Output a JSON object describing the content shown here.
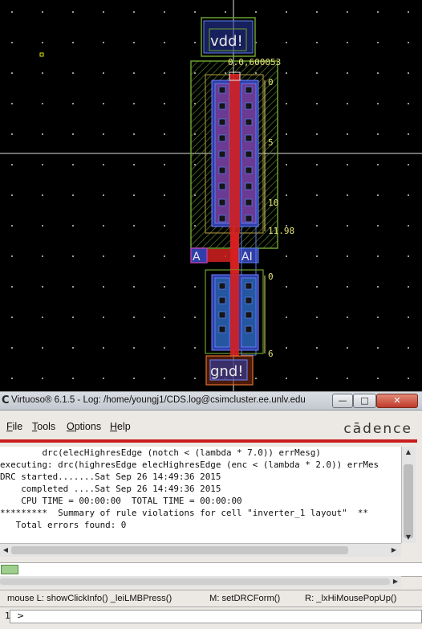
{
  "layout": {
    "pins": {
      "vdd": "vdd!",
      "gnd": "gnd!",
      "input": "A",
      "output": "AI"
    },
    "coordinate_readout": "0.0,600053",
    "ruler_top": [
      "0",
      "5",
      "10",
      "11.98"
    ],
    "ruler_bottom": [
      "0",
      "6"
    ],
    "colors": {
      "background": "#000000",
      "metal1": "#3a4bd0",
      "poly": "#d42020",
      "nwell": "#6aa02e",
      "contact": "#151515",
      "pin_label": "#e8e8e8"
    }
  },
  "window": {
    "title": "Virtuoso® 6.1.5 - Log: /home/youngj1/CDS.log@csimcluster.ee.unlv.edu",
    "icon": "cadence-c-icon",
    "buttons": [
      "minimize",
      "maximize",
      "close"
    ]
  },
  "menubar": {
    "items": [
      {
        "label": "File",
        "accel": "F",
        "rest": "ile"
      },
      {
        "label": "Tools",
        "accel": "T",
        "rest": "ools"
      },
      {
        "label": "Options",
        "accel": "O",
        "rest": "ptions"
      },
      {
        "label": "Help",
        "accel": "H",
        "rest": "elp"
      }
    ],
    "logo": "cādence"
  },
  "log": {
    "lines": [
      "        drc(elecHighresEdge (notch < (lambda * 7.0)) errMesg)",
      "executing: drc(highresEdge elecHighresEdge (enc < (lambda * 2.0)) errMes",
      "DRC started.......Sat Sep 26 14:49:36 2015",
      "    completed ....Sat Sep 26 14:49:36 2015",
      "    CPU TIME = 00:00:00  TOTAL TIME = 00:00:00",
      "*********  Summary of rule violations for cell \"inverter_1 layout\"  **",
      "   Total errors found: 0"
    ]
  },
  "statusbar": {
    "mouse_l": "mouse L: showClickInfo() _leiLMBPress()",
    "mouse_m": "M: setDRCForm()",
    "mouse_r": "R: _lxHiMousePopUp()",
    "prompt_number": "1",
    "prompt_symbol": ">"
  }
}
